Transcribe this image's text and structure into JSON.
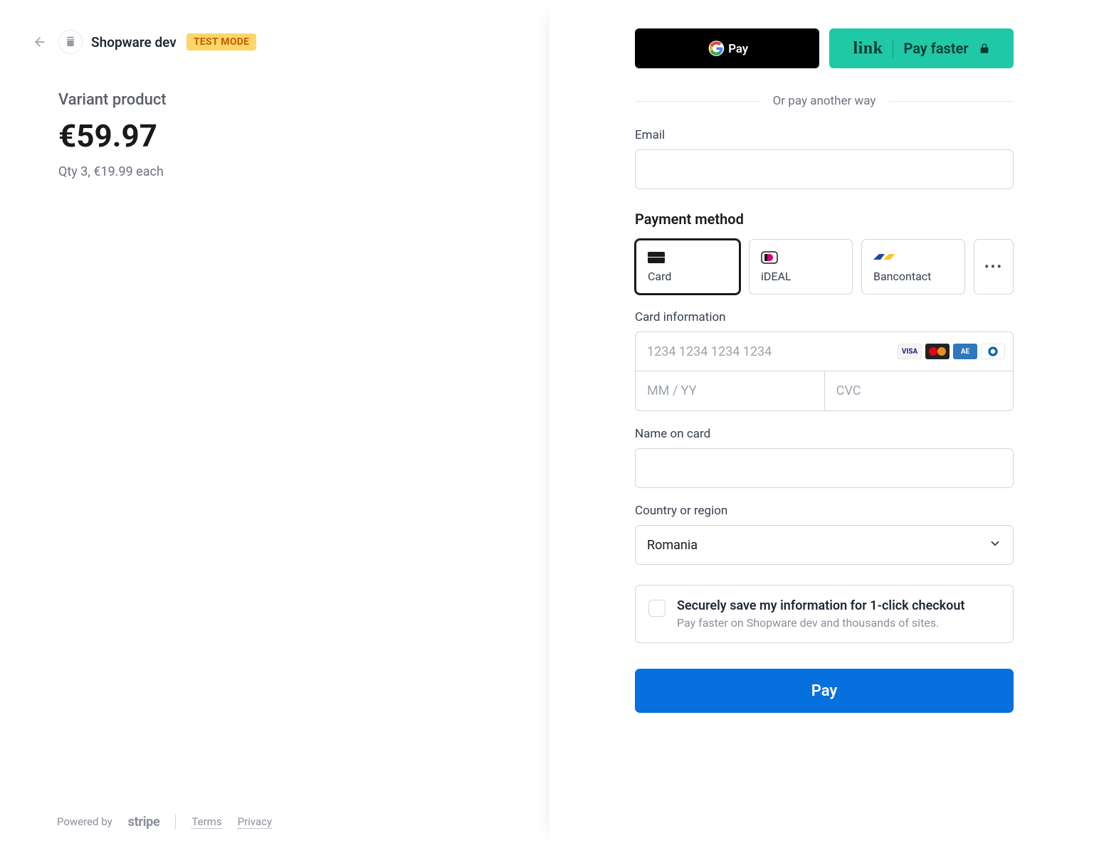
{
  "merchant": {
    "name": "Shopware dev",
    "badge": "TEST MODE"
  },
  "product": {
    "name": "Variant product",
    "price": "€59.97",
    "subline": "Qty 3, €19.99 each"
  },
  "express": {
    "gpay_aria": "Google Pay",
    "link_text": "link",
    "link_cta": "Pay faster"
  },
  "divider_text": "Or pay another way",
  "email_label": "Email",
  "payment_method_title": "Payment method",
  "methods": [
    {
      "id": "card",
      "label": "Card",
      "selected": true
    },
    {
      "id": "ideal",
      "label": "iDEAL",
      "selected": false
    },
    {
      "id": "bancontact",
      "label": "Bancontact",
      "selected": false
    }
  ],
  "more_methods_label": "…",
  "card_info": {
    "label": "Card information",
    "number_placeholder": "1234 1234 1234 1234",
    "expiry_placeholder": "MM / YY",
    "cvc_placeholder": "CVC"
  },
  "name_on_card_label": "Name on card",
  "country_label": "Country or region",
  "country_value": "Romania",
  "save": {
    "title": "Securely save my information for 1-click checkout",
    "sub": "Pay faster on Shopware dev and thousands of sites."
  },
  "pay_button": "Pay",
  "footer": {
    "powered_by": "Powered by",
    "brand": "stripe",
    "terms": "Terms",
    "privacy": "Privacy"
  }
}
